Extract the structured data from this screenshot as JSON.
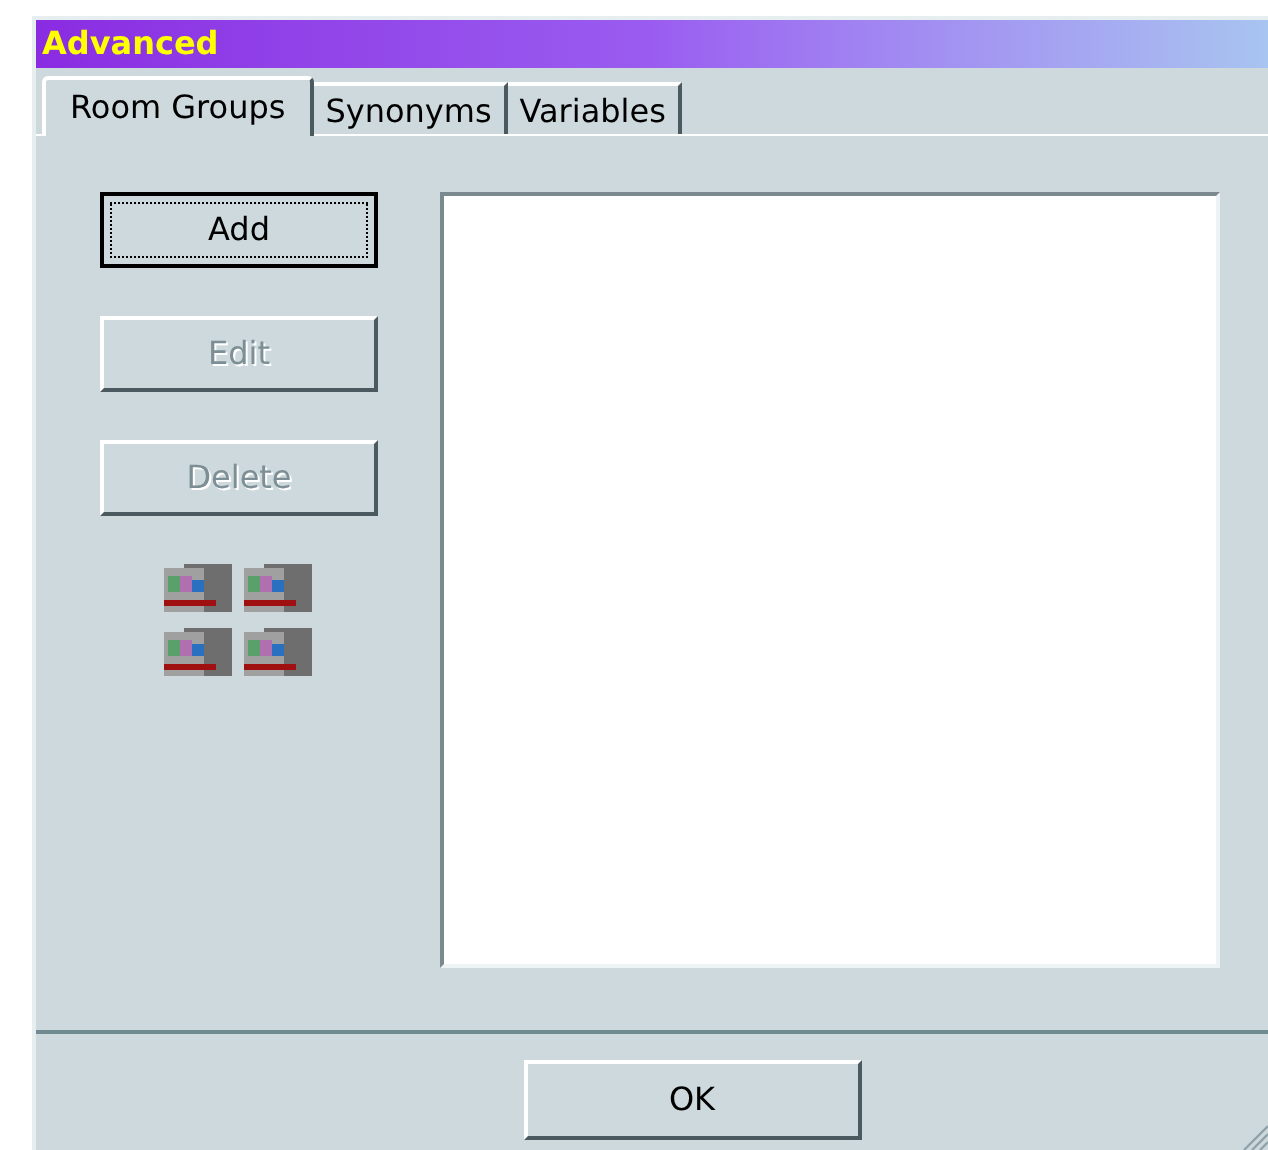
{
  "window": {
    "title": "Advanced"
  },
  "tabs": [
    {
      "label": "Room Groups",
      "selected": true
    },
    {
      "label": "Synonyms",
      "selected": false
    },
    {
      "label": "Variables",
      "selected": false
    }
  ],
  "buttons": [
    {
      "label": "Add",
      "disabled": false,
      "focused": true
    },
    {
      "label": "Edit",
      "disabled": true,
      "focused": false
    },
    {
      "label": "Delete",
      "disabled": true,
      "focused": false
    }
  ],
  "footer_buttons": [
    "OK"
  ]
}
